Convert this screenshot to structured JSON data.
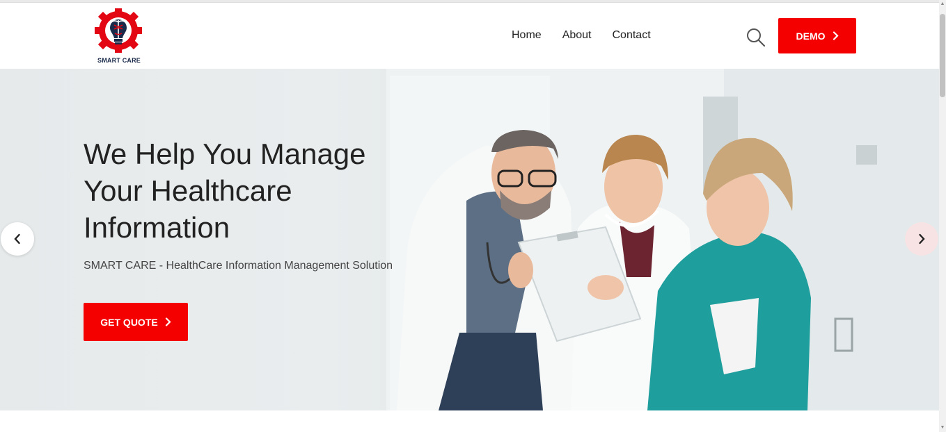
{
  "brand": {
    "name": "SMART CARE",
    "logo_icon": "gear-caduceus-bulb-logo",
    "accent_color": "#f50000"
  },
  "nav": {
    "items": [
      {
        "label": "Home"
      },
      {
        "label": "About"
      },
      {
        "label": "Contact"
      }
    ]
  },
  "header": {
    "search_icon": "search-icon",
    "demo_label": "DEMO"
  },
  "hero": {
    "title": "We Help You Manage Your Healthcare Information",
    "subtitle": "SMART CARE - HealthCare Information Management Solution",
    "cta_label": "GET QUOTE",
    "image_desc": "doctors-reviewing-clipboard-photo",
    "prev_icon": "chevron-left-icon",
    "next_icon": "chevron-right-icon"
  }
}
